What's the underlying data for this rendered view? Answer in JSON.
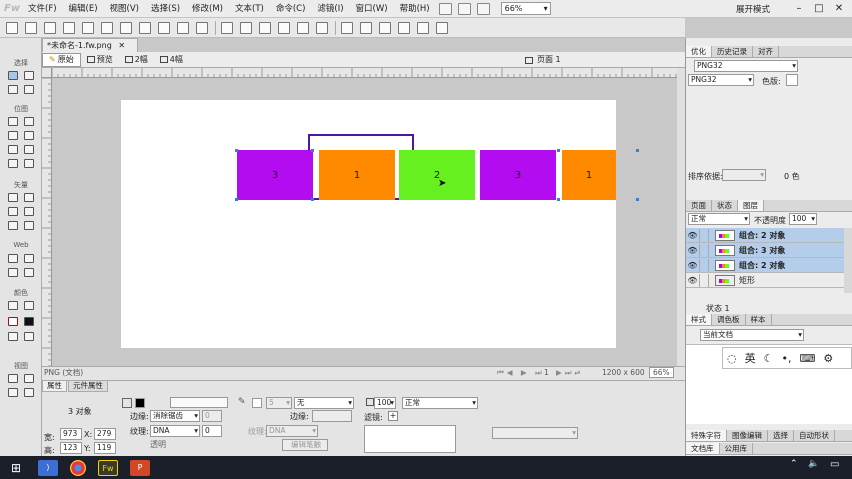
{
  "app": {
    "logo": "Fw",
    "doc_tab": "*未命名-1.fw.png",
    "expand_mode": "展开模式"
  },
  "menu": [
    "文件(F)",
    "编辑(E)",
    "视图(V)",
    "选择(S)",
    "修改(M)",
    "文本(T)",
    "命令(C)",
    "滤镜(I)",
    "窗口(W)",
    "帮助(H)"
  ],
  "zoom": "66%",
  "view_tabs": {
    "original": "原始",
    "preview": "预览",
    "two_up": "2幅",
    "four_up": "4幅",
    "page": "页面 1"
  },
  "tools_groups": {
    "select": "选择",
    "bitmap": "位图",
    "vector": "矢量",
    "web": "Web",
    "color": "颜色",
    "view": "视图"
  },
  "canvas": {
    "boxes": [
      {
        "label": "3",
        "color": "#b30cf0"
      },
      {
        "label": "1",
        "color": "#ff8a00"
      },
      {
        "label": "2",
        "color": "#66f020"
      },
      {
        "label": "3",
        "color": "#b30cf0"
      },
      {
        "label": "1",
        "color": "#ff8a00"
      }
    ],
    "outline_color": "#4a18a8"
  },
  "statusbar": {
    "left": "PNG (文档)",
    "page": "1",
    "size": "1200 x 600",
    "zoom": "66%"
  },
  "props": {
    "tabs": [
      "属性",
      "元件属性"
    ],
    "selection": "3 对象",
    "w_label": "宽:",
    "w": "973",
    "x_label": "X:",
    "x": "279",
    "h_label": "高:",
    "h": "123",
    "y_label": "Y:",
    "y": "119",
    "edge_label": "边缘:",
    "edge_value": "消除锯齿",
    "edge_num": "0",
    "texture_label": "纹理:",
    "texture_value": "DNA",
    "texture_num": "0",
    "transparent": "透明",
    "stroke_size": "5",
    "stroke_type": "无",
    "edge2_label": "边缘:",
    "texture2_label": "纹理:",
    "texture2_value": "DNA",
    "edit_stroke": "编辑笔触",
    "opacity": "100",
    "blend": "正常",
    "filters_label": "滤镜:"
  },
  "panel": {
    "top_tabs": [
      "优化",
      "历史记录",
      "对齐"
    ],
    "format1": "PNG32",
    "format2": "PNG32",
    "colors_label": "色版:",
    "sort_label": "排序依据:",
    "color_count": "0 色",
    "layer_tabs": [
      "页面",
      "状态",
      "图层"
    ],
    "blend": "正常",
    "opacity_label": "不透明度",
    "opacity": "100",
    "layers": [
      {
        "name": "组合: 2 对象",
        "selected": true
      },
      {
        "name": "组合: 3 对象",
        "selected": true
      },
      {
        "name": "组合: 2 对象",
        "selected": true
      },
      {
        "name": "矩形",
        "selected": false
      }
    ],
    "state_label": "状态 1",
    "style_tabs": [
      "样式",
      "调色板",
      "样本"
    ],
    "style_doc": "当前文档",
    "ime_lang": "英",
    "bottom_tabs1": [
      "特殊字符",
      "图像编辑",
      "选择",
      "自动形状"
    ],
    "bottom_tabs2": [
      "文档库",
      "公用库"
    ]
  },
  "taskbar": {
    "time": ""
  }
}
